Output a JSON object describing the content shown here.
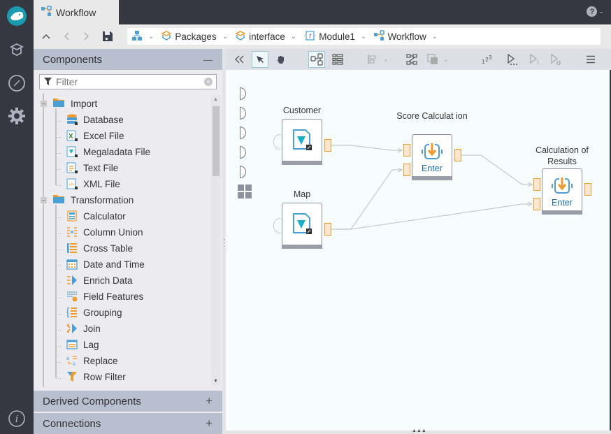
{
  "app": {
    "tab_title": "Workflow",
    "help_label": "?"
  },
  "breadcrumb": [
    {
      "label": "",
      "icon": "hierarchy-icon"
    },
    {
      "label": "Packages",
      "icon": "package-icon"
    },
    {
      "label": "interface",
      "icon": "package-icon"
    },
    {
      "label": "Module1",
      "icon": "module-icon"
    },
    {
      "label": "Workflow",
      "icon": "workflow-icon"
    }
  ],
  "panel": {
    "components_title": "Components",
    "filter_placeholder": "Filter",
    "derived_title": "Derived Components",
    "connections_title": "Connections",
    "collapse_symbol": "—",
    "expand_symbol": "+",
    "groups": [
      {
        "label": "Import",
        "items": [
          "Database",
          "Excel File",
          "Megaladata File",
          "Text File",
          "XML File"
        ]
      },
      {
        "label": "Transformation",
        "items": [
          "Calculator",
          "Column Union",
          "Cross Table",
          "Date and Time",
          "Enrich Data",
          "Field Features",
          "Grouping",
          "Join",
          "Lag",
          "Replace",
          "Row Filter"
        ]
      }
    ]
  },
  "canvas": {
    "nodes": [
      {
        "id": "customer",
        "label": "Customer",
        "type": "import"
      },
      {
        "id": "map",
        "label": "Map",
        "type": "import"
      },
      {
        "id": "score",
        "label": "Score Calculat ion",
        "type": "submodel",
        "action": "Enter"
      },
      {
        "id": "results",
        "label": "Calculation of Results",
        "type": "submodel",
        "action": "Enter"
      }
    ],
    "links": [
      [
        "customer",
        "score",
        0
      ],
      [
        "map",
        "score",
        1
      ],
      [
        "score",
        "results",
        0
      ],
      [
        "map",
        "results",
        1
      ]
    ]
  },
  "colors": {
    "accent_orange": "#ef9a2d",
    "accent_blue": "#4a9fd6",
    "panel_header": "#b8bfce",
    "dark_bar": "#353841"
  }
}
